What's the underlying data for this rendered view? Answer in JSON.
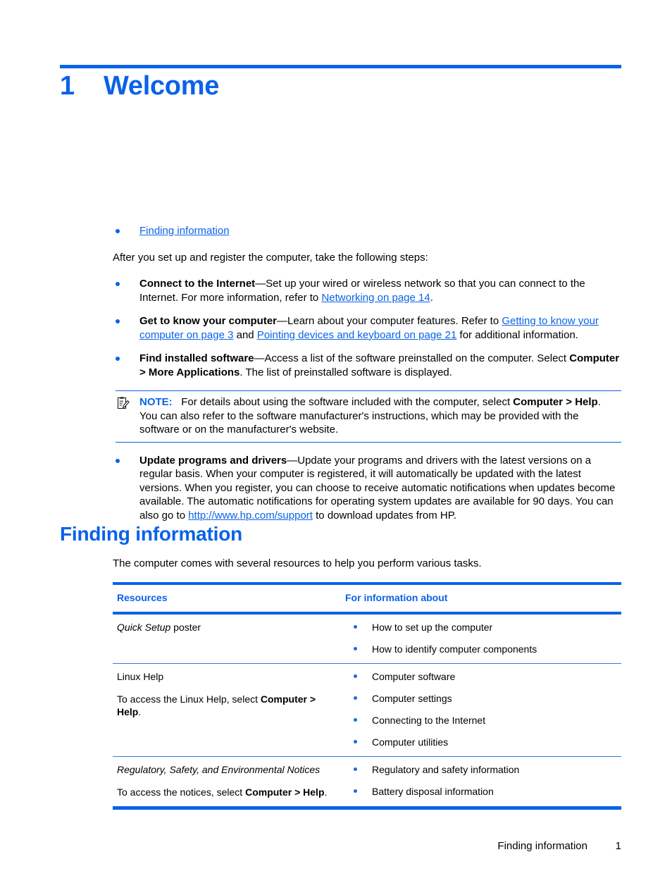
{
  "chapter": {
    "number": "1",
    "title": "Welcome"
  },
  "colors": {
    "accent": "#0a63e8",
    "text": "#000000",
    "link": "#0a63e8"
  },
  "intro": {
    "toc_link": "Finding information",
    "lead": "After you set up and register the computer, take the following steps:",
    "bullets": [
      {
        "term": "Connect to the Internet",
        "dash": "—",
        "text_1": "Set up your wired or wireless network so that you can connect to the Internet. For more information, refer to ",
        "link_1": "Networking on page 14",
        "text_2": "."
      },
      {
        "term": "Get to know your computer",
        "dash": "—",
        "text_1": "Learn about your computer features. Refer to ",
        "link_1": "Getting to know your computer on page 3",
        "text_2": " and ",
        "link_2": "Pointing devices and keyboard on page 21",
        "text_3": " for additional information."
      },
      {
        "term": "Find installed software",
        "dash": "—",
        "text_1": "Access a list of the software preinstalled on the computer. Select ",
        "bold_1": "Computer > More Applications",
        "text_2": ". The list of preinstalled software is displayed."
      }
    ],
    "note": {
      "icon": "note-clipboard-pencil-icon",
      "label": "NOTE:",
      "text_1": "For details about using the software included with the computer, select ",
      "bold_1": "Computer > Help",
      "text_2": ". You can also refer to the software manufacturer's instructions, which may be provided with the software or on the manufacturer's website."
    },
    "bullets_after_note": [
      {
        "term": "Update programs and drivers",
        "dash": "—",
        "text_1": "Update your programs and drivers with the latest versions on a regular basis. When your computer is registered, it will automatically be updated with the latest versions. When you register, you can choose to receive automatic notifications when updates become available. The automatic notifications for operating system updates are available for 90 days. You can also go to ",
        "link_1": "http://www.hp.com/support",
        "text_2": " to download updates from HP."
      }
    ]
  },
  "section": {
    "heading": "Finding information",
    "intro": "The computer comes with several resources to help you perform various tasks.",
    "table": {
      "headers": [
        "Resources",
        "For information about"
      ],
      "rows": [
        {
          "resource_lines": [
            {
              "italic": "Quick Setup",
              "plain": " poster"
            }
          ],
          "info": [
            "How to set up the computer",
            "How to identify computer components"
          ]
        },
        {
          "resource_lines": [
            {
              "plain": "Linux Help"
            },
            {
              "plain_pre": "To access the Linux Help, select ",
              "bold": "Computer > Help",
              "plain_post": "."
            }
          ],
          "info": [
            "Computer software",
            "Computer settings",
            "Connecting to the Internet",
            "Computer utilities"
          ]
        },
        {
          "resource_lines": [
            {
              "italic": "Regulatory, Safety, and Environmental Notices"
            },
            {
              "plain_pre": "To access the notices, select ",
              "bold": "Computer > Help",
              "plain_post": "."
            }
          ],
          "info": [
            "Regulatory and safety information",
            "Battery disposal information"
          ]
        }
      ]
    }
  },
  "footer": {
    "section_label": "Finding information",
    "page_number": "1"
  }
}
